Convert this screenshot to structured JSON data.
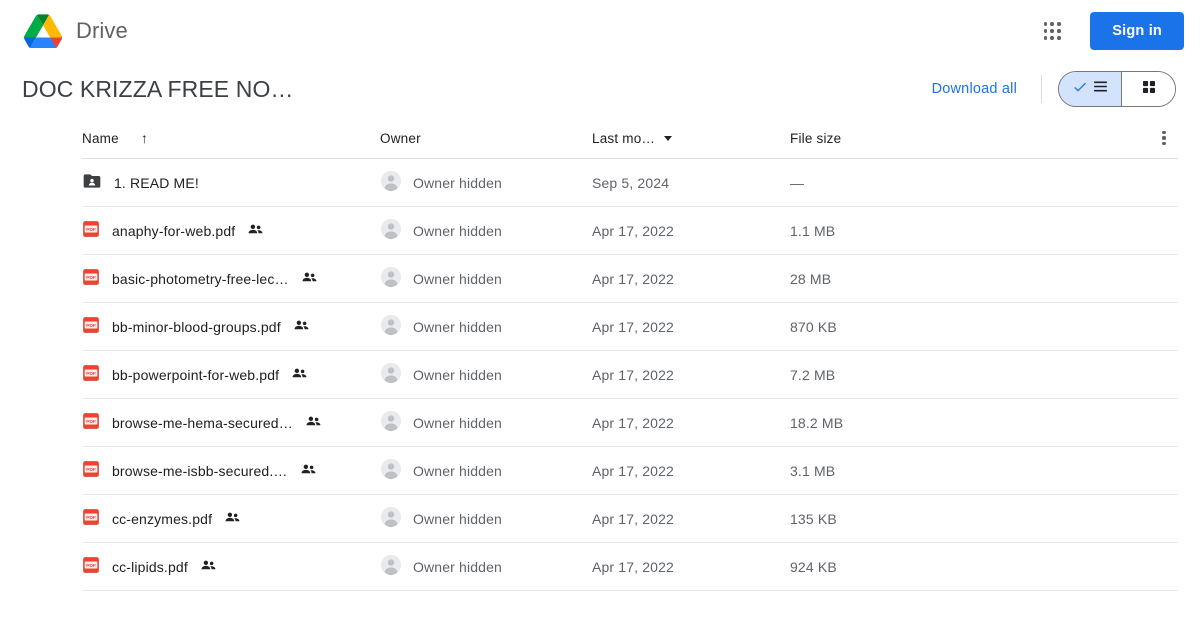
{
  "header": {
    "brand": "Drive",
    "logo_icon": "google-drive-logo",
    "apps_icon": "apps-grid-icon",
    "signin_label": "Sign in",
    "accent_blue": "#1a73e8"
  },
  "titlebar": {
    "doc_title": "DOC KRIZZA FREE NO…",
    "download_all_label": "Download all",
    "view_list_icon": "list-view-icon",
    "view_list_check_icon": "check-icon",
    "view_grid_icon": "grid-view-icon",
    "selected_view": "list",
    "selected_bg": "#d3e3fd"
  },
  "table": {
    "columns": {
      "name": "Name",
      "owner": "Owner",
      "last_modified": "Last mo…",
      "file_size": "File size"
    },
    "sort": {
      "column": "Name",
      "direction_icon": "arrow-up-icon",
      "arrow_glyph": "↑"
    },
    "more_menu_icon": "more-vertical-icon",
    "rows": [
      {
        "icon": "shared-folder-icon",
        "type": "folder",
        "name": "1. READ ME!",
        "shared": false,
        "owner": "Owner hidden",
        "modified": "Sep 5, 2024",
        "size": "—"
      },
      {
        "icon": "pdf-file-icon",
        "type": "pdf",
        "name": "anaphy-for-web.pdf",
        "shared": true,
        "owner": "Owner hidden",
        "modified": "Apr 17, 2022",
        "size": "1.1 MB"
      },
      {
        "icon": "pdf-file-icon",
        "type": "pdf",
        "name": "basic-photometry-free-lec…",
        "shared": true,
        "owner": "Owner hidden",
        "modified": "Apr 17, 2022",
        "size": "28 MB"
      },
      {
        "icon": "pdf-file-icon",
        "type": "pdf",
        "name": "bb-minor-blood-groups.pdf",
        "shared": true,
        "owner": "Owner hidden",
        "modified": "Apr 17, 2022",
        "size": "870 KB"
      },
      {
        "icon": "pdf-file-icon",
        "type": "pdf",
        "name": "bb-powerpoint-for-web.pdf",
        "shared": true,
        "owner": "Owner hidden",
        "modified": "Apr 17, 2022",
        "size": "7.2 MB"
      },
      {
        "icon": "pdf-file-icon",
        "type": "pdf",
        "name": "browse-me-hema-secured…",
        "shared": true,
        "owner": "Owner hidden",
        "modified": "Apr 17, 2022",
        "size": "18.2 MB"
      },
      {
        "icon": "pdf-file-icon",
        "type": "pdf",
        "name": "browse-me-isbb-secured.…",
        "shared": true,
        "owner": "Owner hidden",
        "modified": "Apr 17, 2022",
        "size": "3.1 MB"
      },
      {
        "icon": "pdf-file-icon",
        "type": "pdf",
        "name": "cc-enzymes.pdf",
        "shared": true,
        "owner": "Owner hidden",
        "modified": "Apr 17, 2022",
        "size": "135 KB"
      },
      {
        "icon": "pdf-file-icon",
        "type": "pdf",
        "name": "cc-lipids.pdf",
        "shared": true,
        "owner": "Owner hidden",
        "modified": "Apr 17, 2022",
        "size": "924 KB"
      }
    ]
  }
}
